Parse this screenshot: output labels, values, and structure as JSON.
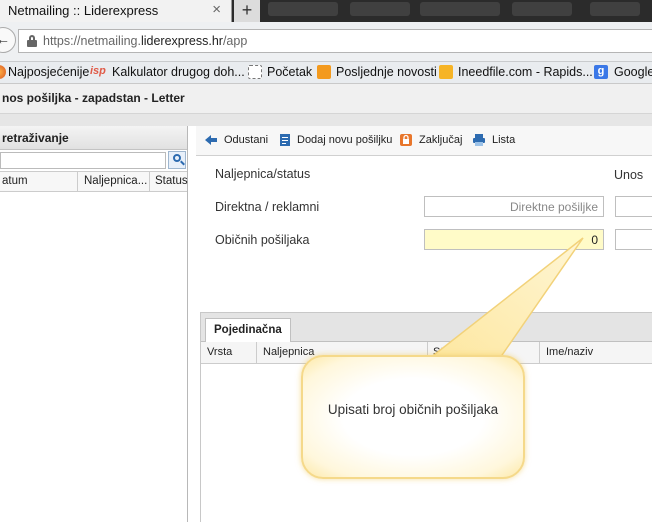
{
  "browser": {
    "tab_title": "Netmailing :: Liderexpress",
    "close_glyph": "×",
    "new_tab_glyph": "+",
    "url_prefix": "https://netmailing.",
    "url_domain": "liderexpress.hr",
    "url_path": "/app"
  },
  "bookmarks": [
    {
      "label": "Najposjećenije",
      "icon": "firefox-icon"
    },
    {
      "label": "Kalkulator drugog doh...",
      "icon": "isp-icon",
      "icon_text": "isp"
    },
    {
      "label": "Početak",
      "icon": "page-icon"
    },
    {
      "label": "Posljednje novosti",
      "icon": "rss-icon"
    },
    {
      "label": "Ineedfile.com - Rapids...",
      "icon": "mail-icon"
    },
    {
      "label": "Google",
      "icon": "google-icon",
      "icon_text": "g"
    }
  ],
  "app": {
    "title": "nos pošiljka - zapadstan - Letter"
  },
  "left_panel": {
    "title": "retraživanje",
    "columns": [
      "atum",
      "Naljepnica...",
      "Status"
    ]
  },
  "toolbar": {
    "items": [
      {
        "label": "Odustani",
        "icon": "arrow-left-icon"
      },
      {
        "label": "Dodaj novu pošiljku",
        "icon": "document-icon"
      },
      {
        "label": "Zaključaj",
        "icon": "lock-icon"
      },
      {
        "label": "Lista",
        "icon": "print-icon"
      }
    ]
  },
  "form": {
    "status_label": "Naljepnica/status",
    "unos_label": "Unos",
    "direct_label": "Direktna / reklamni",
    "direct_placeholder": "Direktne pošiljke",
    "regular_label": "Običnih pošiljaka",
    "regular_value": "0"
  },
  "grid": {
    "tab": "Pojedinačna",
    "columns": [
      "Vrsta",
      "Naljepnica",
      "Sta",
      "Ime/naziv"
    ]
  },
  "callout": {
    "text": "Upisati broj običnih pošiljaka"
  },
  "colors": {
    "toolbar_icon_blue": "#2d6bb0",
    "lock_orange": "#e8762b",
    "highlight_field": "#fffbc8",
    "callout_border": "#f5d98a"
  }
}
